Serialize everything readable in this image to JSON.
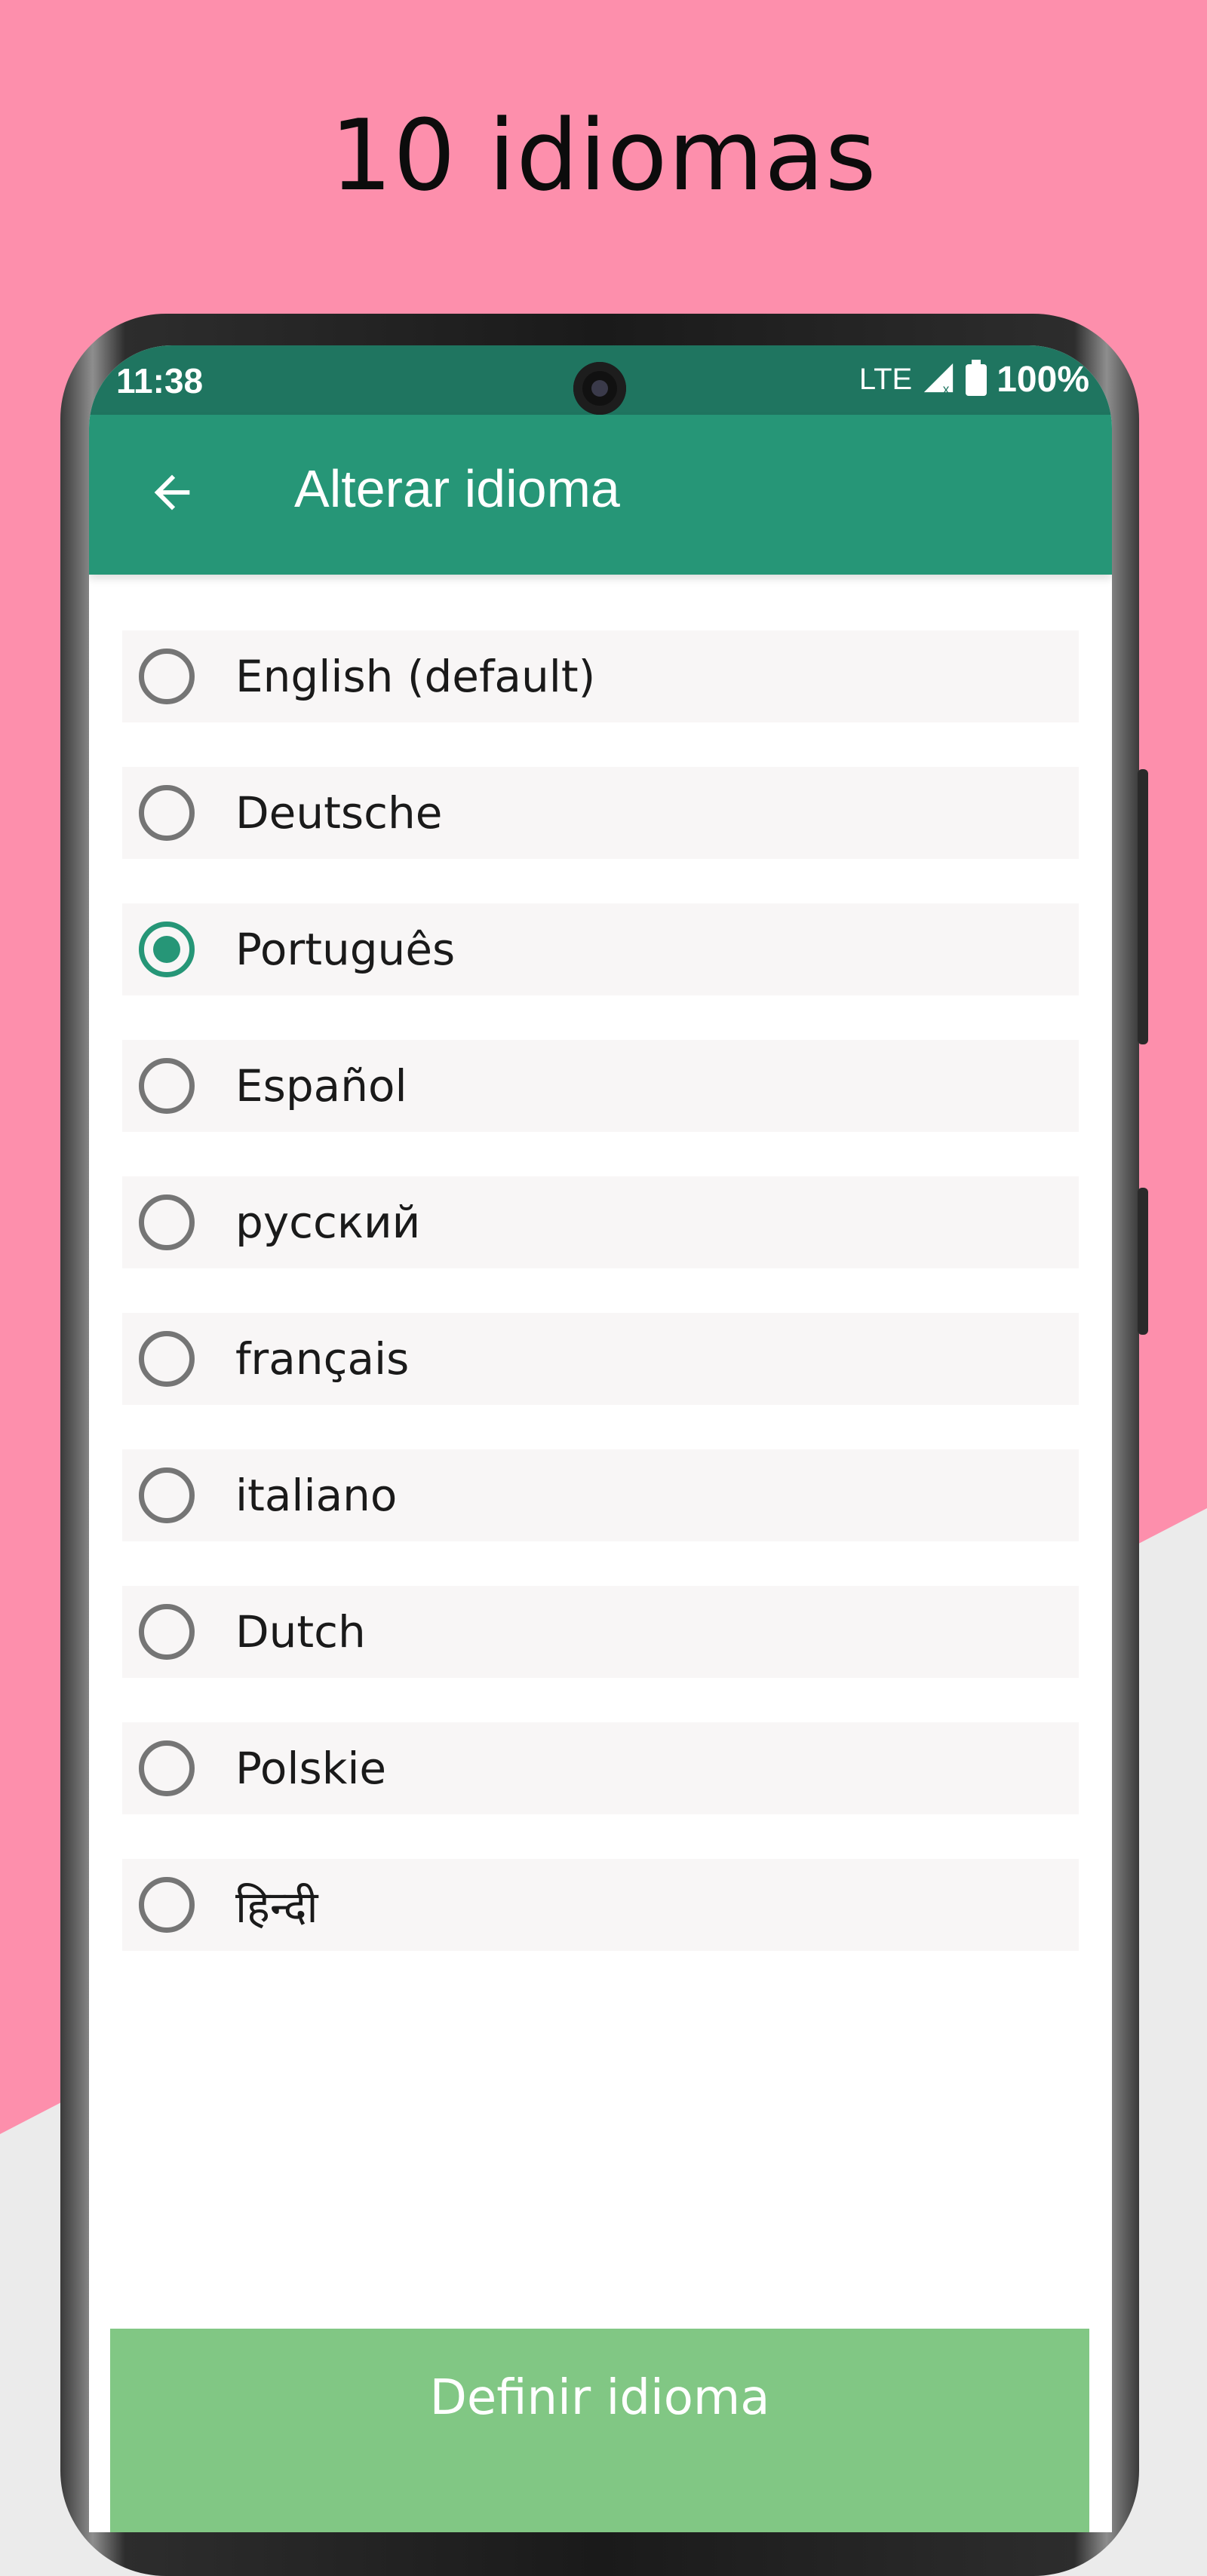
{
  "promo": {
    "headline": "10 idiomas"
  },
  "status_bar": {
    "time": "11:38",
    "network": "LTE",
    "battery": "100%"
  },
  "app_bar": {
    "back_icon": "arrow-back-icon",
    "title": "Alterar idioma"
  },
  "languages": [
    {
      "label": "English (default)",
      "selected": false
    },
    {
      "label": "Deutsche",
      "selected": false
    },
    {
      "label": "Português",
      "selected": true
    },
    {
      "label": "Español",
      "selected": false
    },
    {
      "label": "русский",
      "selected": false
    },
    {
      "label": "français",
      "selected": false
    },
    {
      "label": "italiano",
      "selected": false
    },
    {
      "label": "Dutch",
      "selected": false
    },
    {
      "label": "Polskie",
      "selected": false
    },
    {
      "label": "हिन्दी",
      "selected": false
    }
  ],
  "action": {
    "set_language_label": "Definir idioma"
  },
  "colors": {
    "background_pink": "#fd8fac",
    "background_gray": "#ebebeb",
    "status_bar": "#1f7560",
    "app_bar": "#269677",
    "accent": "#269677",
    "button": "#81c784",
    "row_background": "#f8f6f6"
  }
}
